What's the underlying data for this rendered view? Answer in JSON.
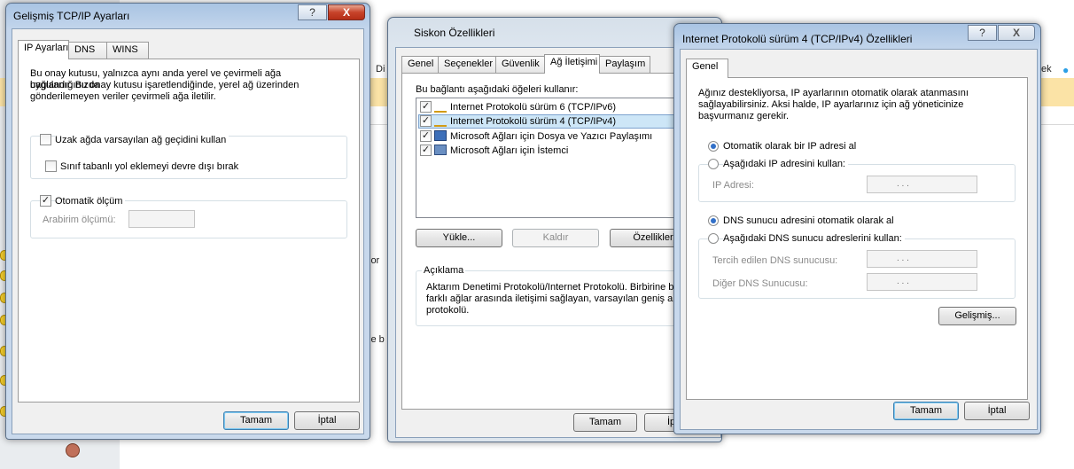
{
  "background": {
    "menu_partial": "Di",
    "right_partial": "ek",
    "left_labels": [
      "lor",
      "le b"
    ]
  },
  "win_gelismis": {
    "title": "Gelişmiş TCP/IP Ayarları",
    "tabs": [
      "IP Ayarları",
      "DNS",
      "WINS"
    ],
    "description": "Bu onay kutusu, yalnızca aynı anda yerel ve çevirmeli ağa bağlandığınızda uygulanır. Bu onay kutusu işaretlendiğinde, yerel ağ üzerinden gönderilemeyen veriler çevirmeli ağa iletilir.",
    "desc_lines": [
      "Bu onay kutusu, yalnızca aynı anda yerel ve çevirmeli ağa bağlandığınızda",
      "uygulanır. Bu onay kutusu işaretlendiğinde, yerel ağ üzerinden",
      "gönderilemeyen veriler çevirmeli ağa iletilir."
    ],
    "remote_gateway_label": "Uzak ağda varsayılan ağ geçidini kullan",
    "remote_gateway_checked": false,
    "class_route_label": "Sınıf tabanlı yol eklemeyi devre dışı bırak",
    "class_route_checked": false,
    "auto_metric_label": "Otomatik ölçüm",
    "auto_metric_checked": true,
    "interface_metric_label": "Arabirim ölçümü:",
    "interface_metric_value": "",
    "ok_label": "Tamam",
    "cancel_label": "İptal",
    "help_glyph": "?",
    "close_glyph": "X"
  },
  "win_siskon": {
    "title": "Siskon Özellikleri",
    "tabs": [
      "Genel",
      "Seçenekler",
      "Güvenlik",
      "Ağ İletişimi",
      "Paylaşım"
    ],
    "items_label": "Bu bağlantı aşağıdaki öğeleri kullanır:",
    "items": [
      {
        "label": "Internet Protokolü sürüm 6 (TCP/IPv6)",
        "checked": true,
        "selected": false
      },
      {
        "label": "Internet Protokolü sürüm 4 (TCP/IPv4)",
        "checked": true,
        "selected": true
      },
      {
        "label": "Microsoft Ağları için Dosya ve Yazıcı Paylaşımı",
        "checked": true,
        "selected": false
      },
      {
        "label": "Microsoft Ağları için İstemci",
        "checked": true,
        "selected": false
      }
    ],
    "install_label": "Yükle...",
    "uninstall_label": "Kaldır",
    "properties_label": "Özellikler",
    "description_title": "Açıklama",
    "desc_lines": [
      "Aktarım Denetimi Protokolü/Internet Protokolü. Birbirine bağl",
      "farklı ağlar arasında iletişimi sağlayan, varsayılan geniş alan a",
      "protokolü."
    ],
    "ok_label": "Tamam",
    "cancel_partial": "İp"
  },
  "win_ipv4": {
    "title": "Internet Protokolü sürüm 4 (TCP/IPv4) Özellikleri",
    "tabs": [
      "Genel"
    ],
    "desc_lines": [
      "Ağınız destekliyorsa, IP ayarlarının otomatik olarak atanmasını",
      "sağlayabilirsiniz. Aksi halde, IP ayarlarınız için ağ yöneticinize",
      "başvurmanız gerekir."
    ],
    "auto_ip_label": "Otomatik olarak bir IP adresi al",
    "manual_ip_label": "Aşağıdaki IP adresini kullan:",
    "ip_mode": "auto",
    "ip_address_label": "IP Adresi:",
    "auto_dns_label": "DNS sunucu adresini otomatik olarak al",
    "manual_dns_label": "Aşağıdaki DNS sunucu adreslerini kullan:",
    "dns_mode": "auto",
    "preferred_dns_label": "Tercih edilen DNS sunucusu:",
    "alternate_dns_label": "Diğer DNS Sunucusu:",
    "ip_dots": ".   .   .",
    "advanced_label": "Gelişmiş...",
    "ok_label": "Tamam",
    "cancel_label": "İptal",
    "help_glyph": "?",
    "close_glyph": "X"
  },
  "colors": {
    "accent_selected": "#cde6f7",
    "default_button_border": "#3c7fb1",
    "close_button": "#c7432a",
    "radio_dot": "#3270c8"
  }
}
